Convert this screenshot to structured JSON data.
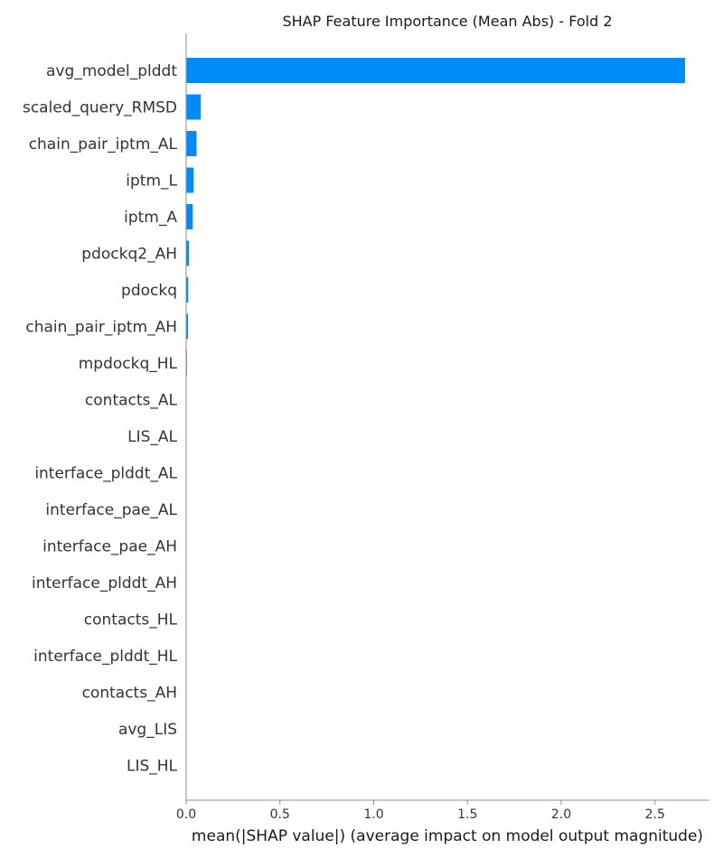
{
  "chart_data": {
    "type": "bar",
    "orientation": "horizontal",
    "title": "SHAP Feature Importance (Mean Abs) - Fold 2",
    "xlabel": "mean(|SHAP value|) (average impact on model output magnitude)",
    "ylabel": "",
    "xlim": [
      0,
      2.8
    ],
    "xticks": [
      "0.0",
      "0.5",
      "1.0",
      "1.5",
      "2.0",
      "2.5"
    ],
    "grid": false,
    "bar_color": "#008bfb",
    "categories": [
      "avg_model_plddt",
      "scaled_query_RMSD",
      "chain_pair_iptm_AL",
      "iptm_L",
      "iptm_A",
      "pdockq2_AH",
      "pdockq",
      "chain_pair_iptm_AH",
      "mpdockq_HL",
      "contacts_AL",
      "LIS_AL",
      "interface_plddt_AL",
      "interface_pae_AL",
      "interface_pae_AH",
      "interface_plddt_AH",
      "contacts_HL",
      "interface_plddt_HL",
      "contacts_AH",
      "avg_LIS",
      "LIS_HL"
    ],
    "values": [
      2.66,
      0.078,
      0.055,
      0.04,
      0.035,
      0.015,
      0.011,
      0.01,
      0.004,
      0.0,
      0.0,
      0.0,
      0.0,
      0.0,
      0.0,
      0.0,
      0.0,
      0.0,
      0.0,
      0.0
    ]
  }
}
